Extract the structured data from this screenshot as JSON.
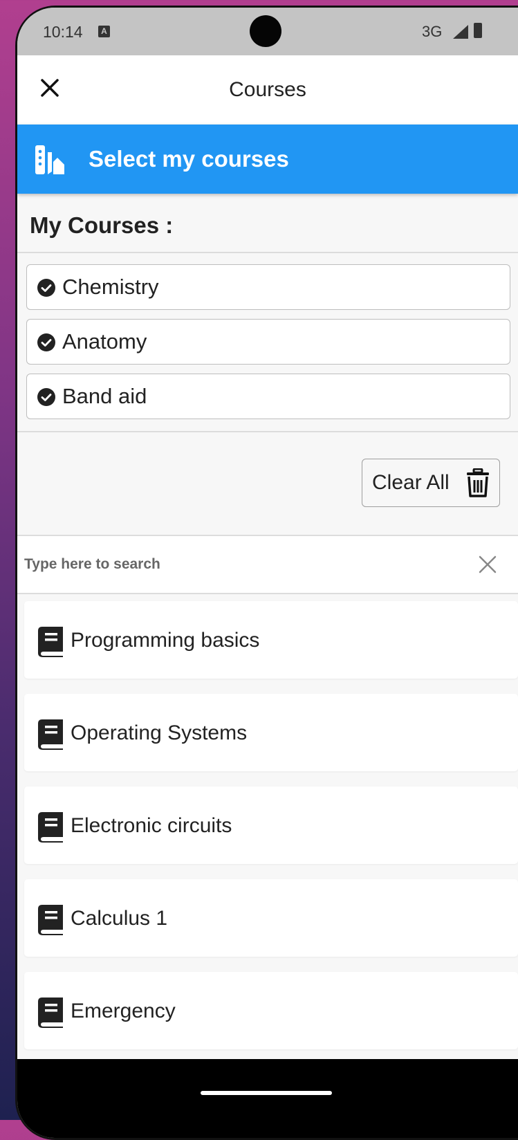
{
  "status_bar": {
    "time": "10:14",
    "notification_icon": "a-icon",
    "network": "3G",
    "signal_icon": "signal-icon",
    "battery_icon": "battery-icon"
  },
  "header": {
    "title": "Courses",
    "close_icon": "close-icon"
  },
  "select_bar": {
    "label": "Select my courses",
    "icon": "palette-icon",
    "color": "#2196f3"
  },
  "my_courses": {
    "title": "My Courses :",
    "items": [
      {
        "label": "Chemistry",
        "icon": "check-circle-icon"
      },
      {
        "label": "Anatomy",
        "icon": "check-circle-icon"
      },
      {
        "label": "Band aid",
        "icon": "check-circle-icon"
      }
    ],
    "clear_all_label": "Clear All",
    "clear_all_icon": "trash-icon"
  },
  "search": {
    "placeholder": "Type here to search",
    "value": "",
    "clear_icon": "close-icon"
  },
  "course_list": [
    {
      "label": "Programming basics",
      "icon": "book-icon"
    },
    {
      "label": "Operating Systems",
      "icon": "book-icon"
    },
    {
      "label": "Electronic circuits",
      "icon": "book-icon"
    },
    {
      "label": "Calculus 1",
      "icon": "book-icon"
    },
    {
      "label": "Emergency",
      "icon": "book-icon"
    }
  ]
}
